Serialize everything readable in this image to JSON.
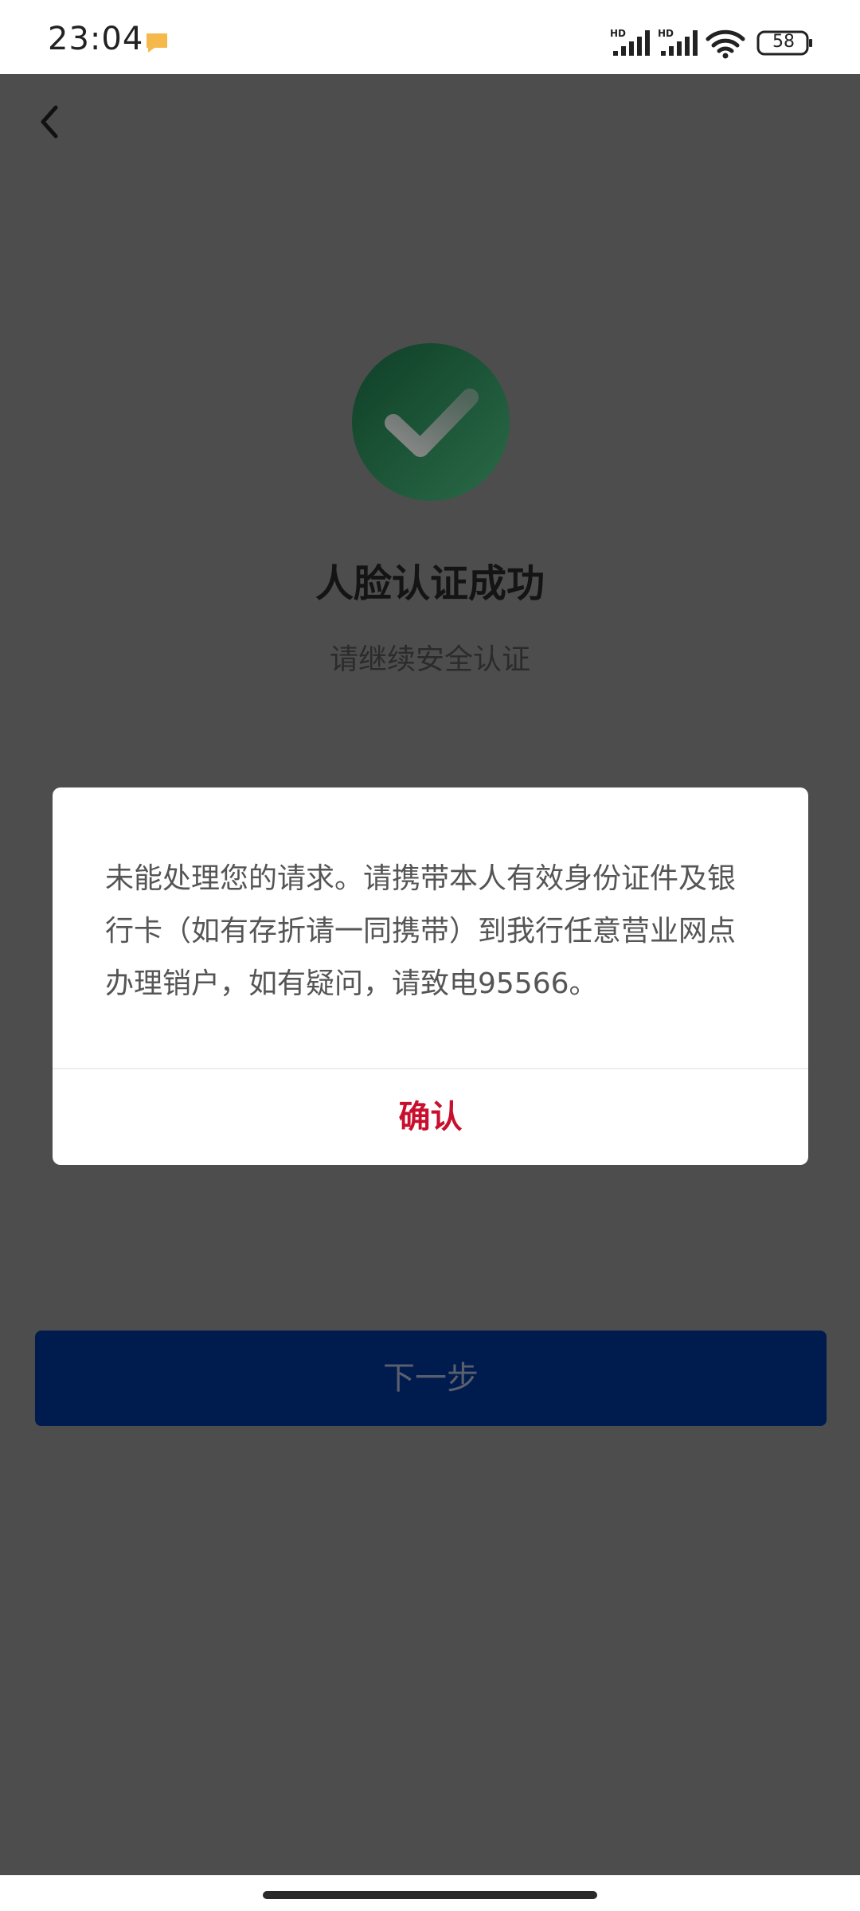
{
  "status_bar": {
    "time": "23:04",
    "battery": "58",
    "signal_tag": "HD",
    "icons": [
      "notification-icon",
      "signal-hd-icon",
      "signal-hd-icon",
      "wifi-icon",
      "battery-icon"
    ]
  },
  "page": {
    "back_icon": "chevron-left-icon",
    "success_icon": "check-circle-icon",
    "title": "人脸认证成功",
    "subtitle": "请继续安全认证",
    "next_button_label": "下一步"
  },
  "dialog": {
    "message": "未能处理您的请求。请携带本人有效身份证件及银行卡（如有存折请一同携带）到我行任意营业网点办理销户，如有疑问，请致电95566。",
    "confirm_label": "确认"
  },
  "colors": {
    "overlay_bg": "#4d4d4d",
    "primary_button": "#001b4d",
    "confirm_text": "#c8102e",
    "success_green": "#1f5a3c"
  }
}
